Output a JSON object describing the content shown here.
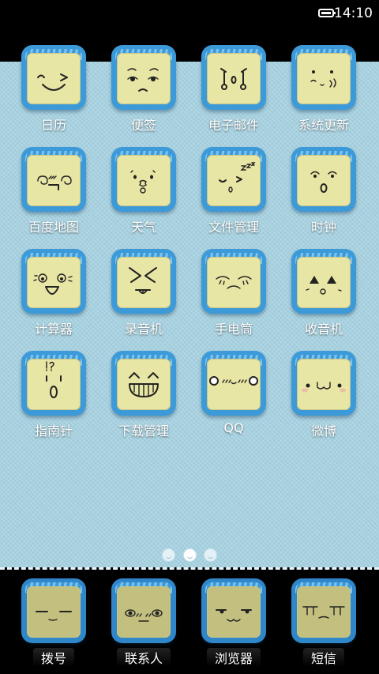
{
  "status_bar": {
    "time": "14:10"
  },
  "apps": [
    {
      "label": "日历",
      "icon": "grinning-face-icon"
    },
    {
      "label": "便签",
      "icon": "worried-face-icon"
    },
    {
      "label": "电子邮件",
      "icon": "shocked-face-icon"
    },
    {
      "label": "系统更新",
      "icon": "sweating-face-icon"
    },
    {
      "label": "百度地图",
      "icon": "dizzy-face-icon"
    },
    {
      "label": "天气",
      "icon": "surprised-face-icon"
    },
    {
      "label": "文件管理",
      "icon": "sleepy-face-icon"
    },
    {
      "label": "时钟",
      "icon": "amazed-face-icon"
    },
    {
      "label": "计算器",
      "icon": "laughing-face-icon"
    },
    {
      "label": "录音机",
      "icon": "squinting-tongue-face-icon"
    },
    {
      "label": "手电筒",
      "icon": "sad-face-icon"
    },
    {
      "label": "收音机",
      "icon": "angry-face-icon"
    },
    {
      "label": "指南针",
      "icon": "confused-face-icon"
    },
    {
      "label": "下载管理",
      "icon": "big-grin-face-icon"
    },
    {
      "label": "QQ",
      "icon": "blushing-face-icon"
    },
    {
      "label": "微博",
      "icon": "cat-face-icon"
    }
  ],
  "page_indicator": {
    "count": 3,
    "active": 2
  },
  "dock": [
    {
      "label": "拨号",
      "icon": "smirk-face-icon"
    },
    {
      "label": "联系人",
      "icon": "staring-face-icon"
    },
    {
      "label": "浏览器",
      "icon": "smug-cat-face-icon"
    },
    {
      "label": "短信",
      "icon": "bored-face-icon"
    }
  ]
}
